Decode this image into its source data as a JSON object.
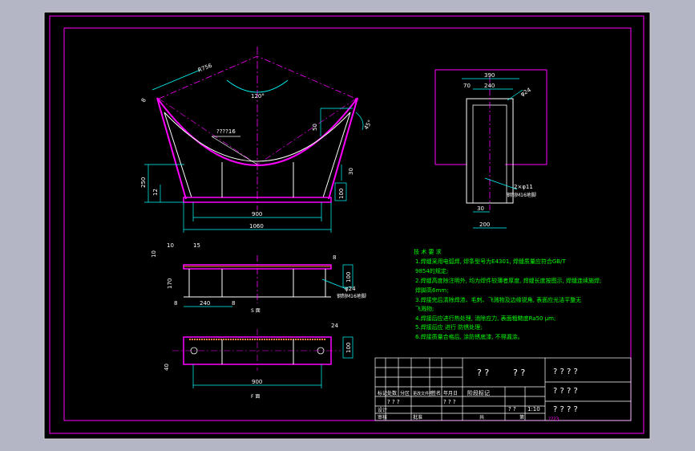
{
  "drawing": {
    "colors": {
      "background": "#000000",
      "frame": "#ff00ff",
      "outline": "#ffffff",
      "dimension": "#00ffff",
      "text": "#00ff00",
      "hatch": "#ff8040",
      "center": "#ff00ff"
    },
    "front_view": {
      "dim_radius": "R756",
      "dim_angle": "120°",
      "dim_top_left": "8",
      "dim_weld": "????16",
      "dim_50": "50",
      "dim_45": "45°",
      "dim_250": "250",
      "dim_12": "12",
      "dim_30": "30",
      "dim_100": "100",
      "dim_900": "900",
      "dim_1060": "1060"
    },
    "side_view": {
      "dim_390": "390",
      "dim_70": "70",
      "dim_240": "240",
      "dim_phi24": "φ24",
      "dim_holes": "2×φ11",
      "note_holes": "钢制M16地脚",
      "dim_30": "30",
      "dim_200": "200"
    },
    "section_view": {
      "dim_10a": "10",
      "dim_15": "15",
      "dim_10b": "10",
      "dim_8_right": "8",
      "dim_100": "100",
      "dim_170": "170",
      "dim_8a": "8",
      "dim_240": "240",
      "dim_8b": "8",
      "dim_phi24": "φ24",
      "note_anchor": "钢制M16地脚",
      "label": "S 面"
    },
    "plan_view": {
      "dim_24": "24",
      "dim_100": "100",
      "dim_40": "40",
      "dim_900": "900",
      "label": "F 面"
    },
    "notes": {
      "title": "技 术 要 求",
      "lines": [
        "1.焊缝采用电弧焊, 焊条型号为E4301, 焊缝质量应符合GB/T",
        "9854的规定;",
        "2.焊缝高度除注明外, 均为焊件较薄者厚度, 焊缝长度按图示, 焊缝连续施焊;",
        "  焊脚高6mm;",
        "3.焊接完后清除焊渣、毛刺、飞溅物及边缘锐角, 表面应光洁平整无",
        "  飞溅物;",
        "4.焊接后应进行热处理, 消除应力, 表面粗糙度Ra50 μm;",
        "5.焊接后应 进行 防锈处理;",
        "6.焊接质量合格后, 涂防锈底漆, 不得漏涂。"
      ]
    },
    "title_block": {
      "part_name": "? ?",
      "part_name2": "? ?",
      "company": [
        "? ? ? ?",
        "? ? ? ?",
        "? ? ? ?",
        "? ? ? ?"
      ],
      "row_labels": [
        "标记",
        "处数",
        "分区",
        "更改文件号",
        "签名",
        "年月日"
      ],
      "cell_a": "? ? ?",
      "cell_b": "? ? ?",
      "cell_stage": "阶段标记",
      "cell_scale_label": "? ?",
      "scale": "1:10",
      "cell_design": "设计",
      "cell_check": "审核",
      "cell_approve": "批准",
      "cell_sheet": "共",
      "cell_sheet2": "第",
      "drawing_number": "???3"
    }
  }
}
